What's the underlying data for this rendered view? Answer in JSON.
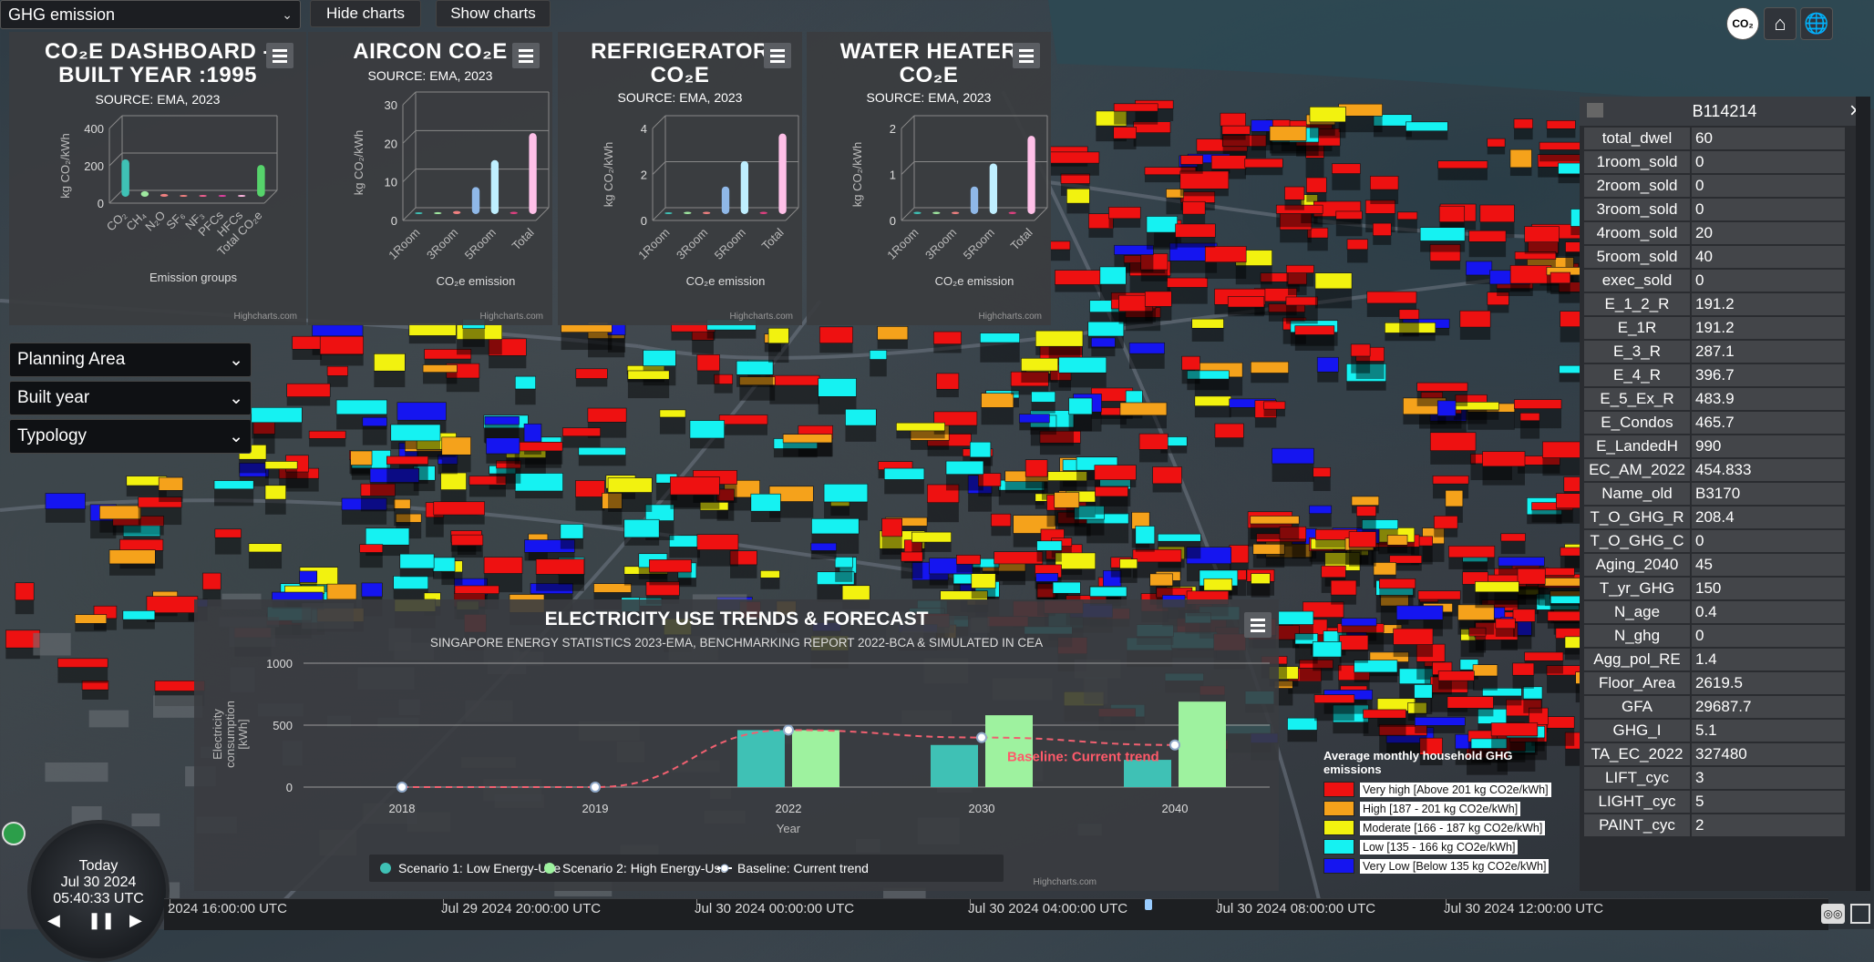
{
  "layer_select": {
    "value": "GHG emission"
  },
  "buttons": {
    "hide_charts": "Hide charts",
    "show_charts": "Show charts"
  },
  "panels": [
    {
      "title_l1": "CO₂E DASHBOARD -",
      "title_l2": "BUILT YEAR :1995",
      "source": "SOURCE: EMA, 2023"
    },
    {
      "title_l1": "AIRCON CO₂E",
      "title_l2": "",
      "source": "SOURCE: EMA, 2023"
    },
    {
      "title_l1": "REFRIGERATOR",
      "title_l2": "CO₂E",
      "source": "SOURCE: EMA, 2023"
    },
    {
      "title_l1": "WATER HEATER",
      "title_l2": "CO₂E",
      "source": "SOURCE: EMA, 2023"
    }
  ],
  "credit": "Highcharts.com",
  "filters": [
    {
      "label": "Planning Area"
    },
    {
      "label": "Built year"
    },
    {
      "label": "Typology"
    }
  ],
  "chart_data": [
    {
      "type": "bar",
      "title": "CO₂E DASHBOARD - BUILT YEAR :1995",
      "subtitle": "SOURCE: EMA, 2023",
      "categories": [
        "CO₂",
        "CH₄",
        "N₂O",
        "SF₆",
        "NF₃",
        "PFCs",
        "HFCs",
        "Total CO₂e"
      ],
      "values": [
        200,
        30,
        15,
        10,
        8,
        8,
        6,
        170
      ],
      "colors": [
        "#3fc1b5",
        "#9fe8a0",
        "#f08080",
        "#f08080",
        "#f06090",
        "#e040a0",
        "#ffb6e0",
        "#56d36b"
      ],
      "xlabel": "Emission groups",
      "ylabel": "kg CO₂/kWh",
      "ylim": [
        0,
        400
      ],
      "yticks": [
        0,
        200,
        400
      ],
      "grid": true
    },
    {
      "type": "bar",
      "title": "AIRCON CO₂E",
      "subtitle": "SOURCE: EMA, 2023",
      "categories": [
        "1Room",
        "",
        "3Room",
        "",
        "5Room",
        "",
        "Total"
      ],
      "values": [
        0.3,
        0.5,
        0.8,
        7,
        14,
        0.6,
        21
      ],
      "colors": [
        "#3fc1b5",
        "#9fe8a0",
        "#f08080",
        "#8fb8e8",
        "#bfefff",
        "#e04080",
        "#ffc0e8"
      ],
      "xlabel": "CO₂e emission",
      "ylabel": "kg CO₂/kWh",
      "ylim": [
        0,
        30
      ],
      "yticks": [
        0,
        10,
        20,
        30
      ],
      "grid": true
    },
    {
      "type": "bar",
      "title": "REFRIGERATOR CO₂E",
      "subtitle": "SOURCE: EMA, 2023",
      "categories": [
        "1Room",
        "",
        "3Room",
        "",
        "5Room",
        "",
        "Total"
      ],
      "values": [
        0.05,
        0.1,
        0.1,
        1.2,
        2.3,
        0.1,
        3.5
      ],
      "colors": [
        "#3fc1b5",
        "#9fe8a0",
        "#f08080",
        "#8fb8e8",
        "#bfefff",
        "#e04080",
        "#ffc0e8"
      ],
      "xlabel": "CO₂e emission",
      "ylabel": "kg CO₂/kWh",
      "ylim": [
        0,
        4
      ],
      "yticks": [
        0,
        2,
        4
      ],
      "grid": true
    },
    {
      "type": "bar",
      "title": "WATER HEATER CO₂E",
      "subtitle": "SOURCE: EMA, 2023",
      "categories": [
        "1Room",
        "",
        "3Room",
        "",
        "5Room",
        "",
        "Total"
      ],
      "values": [
        0.05,
        0.05,
        0.05,
        0.6,
        1.1,
        0.05,
        1.7
      ],
      "colors": [
        "#3fc1b5",
        "#9fe8a0",
        "#f08080",
        "#8fb8e8",
        "#bfefff",
        "#e04080",
        "#ffc0e8"
      ],
      "xlabel": "CO₂e emission",
      "ylabel": "kg CO₂/kWh",
      "ylim": [
        0,
        2
      ],
      "yticks": [
        0,
        1,
        2
      ],
      "grid": true
    },
    {
      "type": "bar",
      "title": "ELECTRICITY USE TRENDS & FORECAST",
      "subtitle": "SINGAPORE ENERGY STATISTICS 2023-EMA, BENCHMARKING REPORT 2022-BCA & SIMULATED IN CEA",
      "categories": [
        "2018",
        "2019",
        "2022",
        "2030",
        "2040"
      ],
      "series": [
        {
          "name": "Scenario 1: Low Energy-Use",
          "type": "bar",
          "color": "#3fc1b5",
          "values": [
            0,
            0,
            460,
            340,
            220
          ]
        },
        {
          "name": "Scenario 2: High Energy-Use",
          "type": "bar",
          "color": "#9ef29f",
          "values": [
            0,
            0,
            460,
            580,
            690
          ]
        },
        {
          "name": "Baseline: Current trend",
          "type": "line",
          "color": "#f06070",
          "values": [
            0,
            0,
            460,
            400,
            340
          ]
        }
      ],
      "annotation": "Baseline: Current trend",
      "xlabel": "Year",
      "ylabel": "Electricity consumption [kWh]",
      "ylim": [
        0,
        1000
      ],
      "yticks": [
        0,
        500,
        1000
      ],
      "grid": true,
      "legend": "bottom"
    }
  ],
  "legend": {
    "title": "Average monthly household GHG emissions",
    "items": [
      {
        "label": "Very high [Above 201 kg CO2e/kWh]",
        "color": "#ee1111"
      },
      {
        "label": "High [187 - 201 kg CO2e/kWh]",
        "color": "#f5a21b"
      },
      {
        "label": "Moderate [166 - 187 kg CO2e/kWh]",
        "color": "#f2f20f"
      },
      {
        "label": "Low [135 - 166 kg CO2e/kWh]",
        "color": "#15f2f2"
      },
      {
        "label": "Very Low [Below 135 kg CO2e/kWh]",
        "color": "#1515f0"
      }
    ]
  },
  "info_panel": {
    "title": "B114214",
    "rows": [
      [
        "total_dwel",
        "60"
      ],
      [
        "1room_sold",
        "0"
      ],
      [
        "2room_sold",
        "0"
      ],
      [
        "3room_sold",
        "0"
      ],
      [
        "4room_sold",
        "20"
      ],
      [
        "5room_sold",
        "40"
      ],
      [
        "exec_sold",
        "0"
      ],
      [
        "E_1_2_R",
        "191.2"
      ],
      [
        "E_1R",
        "191.2"
      ],
      [
        "E_3_R",
        "287.1"
      ],
      [
        "E_4_R",
        "396.7"
      ],
      [
        "E_5_Ex_R",
        "483.9"
      ],
      [
        "E_Condos",
        "465.7"
      ],
      [
        "E_LandedH",
        "990"
      ],
      [
        "EC_AM_2022",
        "454.833"
      ],
      [
        "Name_old",
        "B3170"
      ],
      [
        "T_O_GHG_R",
        "208.4"
      ],
      [
        "T_O_GHG_C",
        "0"
      ],
      [
        "Aging_2040",
        "45"
      ],
      [
        "T_yr_GHG",
        "150"
      ],
      [
        "N_age",
        "0.4"
      ],
      [
        "N_ghg",
        "0"
      ],
      [
        "Agg_pol_RE",
        "1.4"
      ],
      [
        "Floor_Area",
        "2619.5"
      ],
      [
        "GFA",
        "29687.7"
      ],
      [
        "GHG_I",
        "5.1"
      ],
      [
        "TA_EC_2022",
        "327480"
      ],
      [
        "LIFT_cyc",
        "3"
      ],
      [
        "LIGHT_cyc",
        "5"
      ],
      [
        "PAINT_cyc",
        "2"
      ]
    ]
  },
  "top_icons": [
    {
      "name": "co2-icon",
      "glyph": "CO₂"
    },
    {
      "name": "home-icon",
      "glyph": "⌂"
    },
    {
      "name": "globe-icon",
      "glyph": "🌐"
    }
  ],
  "clock": {
    "label": "Today",
    "date": "Jul 30 2024",
    "time": "05:40:33 UTC"
  },
  "timeline": {
    "ticks": [
      "2024 16:00:00 UTC",
      "Jul 29 2024 20:00:00 UTC",
      "Jul 30 2024 00:00:00 UTC",
      "Jul 30 2024 04:00:00 UTC",
      "Jul 30 2024 08:00:00 UTC",
      "Jul 30 2024 12:00:00 UTC"
    ]
  }
}
